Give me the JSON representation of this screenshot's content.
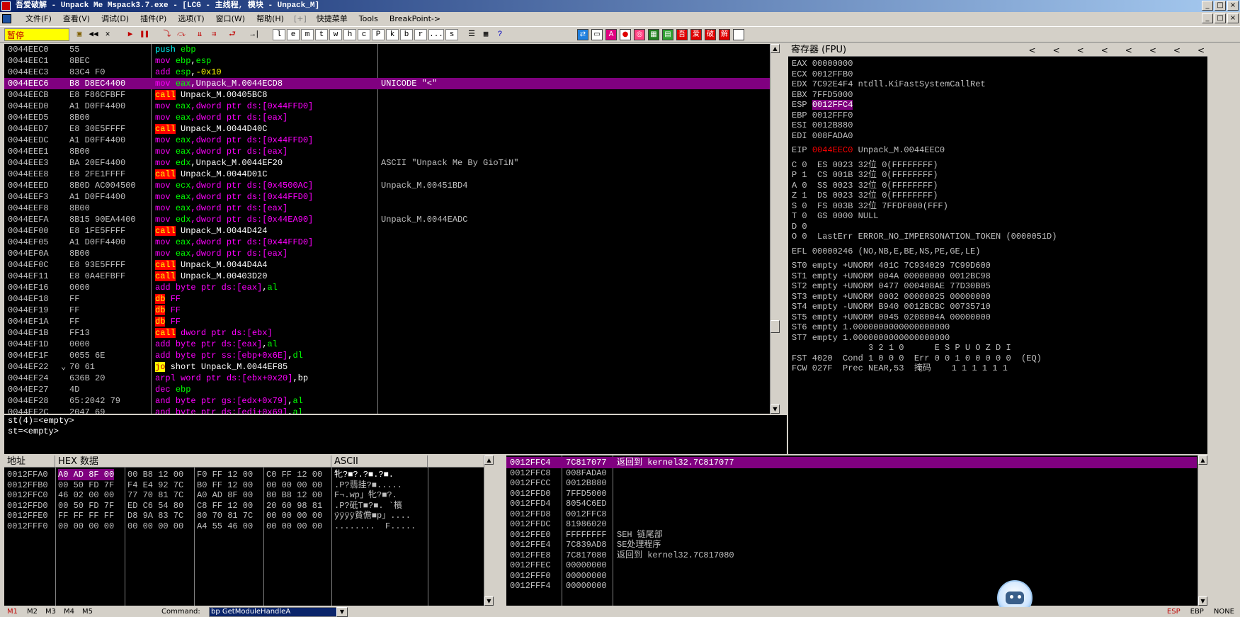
{
  "window": {
    "title": "吾爱破解 - Unpack Me Mspack3.7.exe - [LCG - 主线程, 模块 - Unpack_M]",
    "controls": [
      "_",
      "□",
      "×"
    ]
  },
  "menu": {
    "items": [
      "文件(F)",
      "查看(V)",
      "调试(D)",
      "插件(P)",
      "选项(T)",
      "窗口(W)",
      "帮助(H)"
    ],
    "separator": "[+]",
    "extra": [
      "快捷菜单",
      "Tools",
      "BreakPoint->"
    ]
  },
  "toolbar": {
    "status": "暂停",
    "letters": [
      "l",
      "e",
      "m",
      "t",
      "w",
      "h",
      "c",
      "P",
      "k",
      "b",
      "r",
      "...",
      "s"
    ],
    "right_buttons": [
      "A",
      "●",
      "◎",
      "吾",
      "爱",
      "破",
      "解"
    ]
  },
  "disasm": {
    "rows": [
      {
        "addr": "0044EEC0",
        "hex": "55",
        "mnem": "push",
        "mclass": "push",
        "ops": [
          {
            "t": "ebp",
            "c": "reg"
          }
        ],
        "comment": ""
      },
      {
        "addr": "0044EEC1",
        "hex": "8BEC",
        "mnem": "mov",
        "mclass": "mov",
        "ops": [
          {
            "t": "ebp",
            "c": "reg"
          },
          {
            "t": ",",
            "c": "target"
          },
          {
            "t": "esp",
            "c": "reg"
          }
        ],
        "comment": ""
      },
      {
        "addr": "0044EEC3",
        "hex": "83C4 F0",
        "mnem": "add",
        "mclass": "add",
        "ops": [
          {
            "t": "esp",
            "c": "reg"
          },
          {
            "t": ",",
            "c": "target"
          },
          {
            "t": "-0x10",
            "c": "num"
          }
        ],
        "comment": ""
      },
      {
        "addr": "0044EEC6",
        "hex": "B8 D8EC4400",
        "mnem": "mov",
        "mclass": "mov",
        "ops": [
          {
            "t": "eax",
            "c": "reg"
          },
          {
            "t": ",Unpack_M.0044ECD8",
            "c": "target"
          }
        ],
        "comment": "UNICODE \"<\"",
        "hl": true
      },
      {
        "addr": "0044EECB",
        "hex": "E8 F86CFBFF",
        "mnem": "call",
        "mclass": "call",
        "ops": [
          {
            "t": "Unpack_M.00405BC8",
            "c": "target"
          }
        ],
        "comment": ""
      },
      {
        "addr": "0044EED0",
        "hex": "A1 D0FF4400",
        "mnem": "mov",
        "mclass": "mov",
        "ops": [
          {
            "t": "eax",
            "c": "reg"
          },
          {
            "t": ",dword ptr ds:[0x44FFD0]",
            "c": "mem"
          }
        ],
        "comment": ""
      },
      {
        "addr": "0044EED5",
        "hex": "8B00",
        "mnem": "mov",
        "mclass": "mov",
        "ops": [
          {
            "t": "eax",
            "c": "reg"
          },
          {
            "t": ",dword ptr ds:[eax]",
            "c": "mem"
          }
        ],
        "comment": ""
      },
      {
        "addr": "0044EED7",
        "hex": "E8 30E5FFFF",
        "mnem": "call",
        "mclass": "call",
        "ops": [
          {
            "t": "Unpack_M.0044D40C",
            "c": "target"
          }
        ],
        "comment": ""
      },
      {
        "addr": "0044EEDC",
        "hex": "A1 D0FF4400",
        "mnem": "mov",
        "mclass": "mov",
        "ops": [
          {
            "t": "eax",
            "c": "reg"
          },
          {
            "t": ",dword ptr ds:[0x44FFD0]",
            "c": "mem"
          }
        ],
        "comment": ""
      },
      {
        "addr": "0044EEE1",
        "hex": "8B00",
        "mnem": "mov",
        "mclass": "mov",
        "ops": [
          {
            "t": "eax",
            "c": "reg"
          },
          {
            "t": ",dword ptr ds:[eax]",
            "c": "mem"
          }
        ],
        "comment": ""
      },
      {
        "addr": "0044EEE3",
        "hex": "BA 20EF4400",
        "mnem": "mov",
        "mclass": "mov",
        "ops": [
          {
            "t": "edx",
            "c": "reg"
          },
          {
            "t": ",Unpack_M.0044EF20",
            "c": "target"
          }
        ],
        "comment": "ASCII \"Unpack Me By GioTiN\""
      },
      {
        "addr": "0044EEE8",
        "hex": "E8 2FE1FFFF",
        "mnem": "call",
        "mclass": "call",
        "ops": [
          {
            "t": "Unpack_M.0044D01C",
            "c": "target"
          }
        ],
        "comment": ""
      },
      {
        "addr": "0044EEED",
        "hex": "8B0D AC004500",
        "mnem": "mov",
        "mclass": "mov",
        "ops": [
          {
            "t": "ecx",
            "c": "reg"
          },
          {
            "t": ",dword ptr ds:[0x4500AC]",
            "c": "mem"
          }
        ],
        "comment": "Unpack_M.00451BD4"
      },
      {
        "addr": "0044EEF3",
        "hex": "A1 D0FF4400",
        "mnem": "mov",
        "mclass": "mov",
        "ops": [
          {
            "t": "eax",
            "c": "reg"
          },
          {
            "t": ",dword ptr ds:[0x44FFD0]",
            "c": "mem"
          }
        ],
        "comment": ""
      },
      {
        "addr": "0044EEF8",
        "hex": "8B00",
        "mnem": "mov",
        "mclass": "mov",
        "ops": [
          {
            "t": "eax",
            "c": "reg"
          },
          {
            "t": ",dword ptr ds:[eax]",
            "c": "mem"
          }
        ],
        "comment": ""
      },
      {
        "addr": "0044EEFA",
        "hex": "8B15 90EA4400",
        "mnem": "mov",
        "mclass": "mov",
        "ops": [
          {
            "t": "edx",
            "c": "reg"
          },
          {
            "t": ",dword ptr ds:[0x44EA90]",
            "c": "mem"
          }
        ],
        "comment": "Unpack_M.0044EADC"
      },
      {
        "addr": "0044EF00",
        "hex": "E8 1FE5FFFF",
        "mnem": "call",
        "mclass": "call",
        "ops": [
          {
            "t": "Unpack_M.0044D424",
            "c": "target"
          }
        ],
        "comment": ""
      },
      {
        "addr": "0044EF05",
        "hex": "A1 D0FF4400",
        "mnem": "mov",
        "mclass": "mov",
        "ops": [
          {
            "t": "eax",
            "c": "reg"
          },
          {
            "t": ",dword ptr ds:[0x44FFD0]",
            "c": "mem"
          }
        ],
        "comment": ""
      },
      {
        "addr": "0044EF0A",
        "hex": "8B00",
        "mnem": "mov",
        "mclass": "mov",
        "ops": [
          {
            "t": "eax",
            "c": "reg"
          },
          {
            "t": ",dword ptr ds:[eax]",
            "c": "mem"
          }
        ],
        "comment": ""
      },
      {
        "addr": "0044EF0C",
        "hex": "E8 93E5FFFF",
        "mnem": "call",
        "mclass": "call",
        "ops": [
          {
            "t": "Unpack_M.0044D4A4",
            "c": "target"
          }
        ],
        "comment": ""
      },
      {
        "addr": "0044EF11",
        "hex": "E8 0A4EFBFF",
        "mnem": "call",
        "mclass": "call",
        "ops": [
          {
            "t": "Unpack_M.00403D20",
            "c": "target"
          }
        ],
        "comment": ""
      },
      {
        "addr": "0044EF16",
        "hex": "0000",
        "mnem": "add",
        "mclass": "add",
        "ops": [
          {
            "t": "byte ptr ds:[eax]",
            "c": "mem"
          },
          {
            "t": ",",
            "c": "target"
          },
          {
            "t": "al",
            "c": "reg"
          }
        ],
        "comment": ""
      },
      {
        "addr": "0044EF18",
        "hex": "FF",
        "mnem": "db",
        "mclass": "db",
        "ops": [
          {
            "t": "FF",
            "c": "mem"
          }
        ],
        "comment": ""
      },
      {
        "addr": "0044EF19",
        "hex": "FF",
        "mnem": "db",
        "mclass": "db",
        "ops": [
          {
            "t": "FF",
            "c": "mem"
          }
        ],
        "comment": ""
      },
      {
        "addr": "0044EF1A",
        "hex": "FF",
        "mnem": "db",
        "mclass": "db",
        "ops": [
          {
            "t": "FF",
            "c": "mem"
          }
        ],
        "comment": ""
      },
      {
        "addr": "0044EF1B",
        "hex": "FF13",
        "mnem": "call",
        "mclass": "call",
        "ops": [
          {
            "t": "dword ptr ds:[ebx]",
            "c": "mem"
          }
        ],
        "comment": ""
      },
      {
        "addr": "0044EF1D",
        "hex": "0000",
        "mnem": "add",
        "mclass": "add",
        "ops": [
          {
            "t": "byte ptr ds:[eax]",
            "c": "mem"
          },
          {
            "t": ",",
            "c": "target"
          },
          {
            "t": "al",
            "c": "reg"
          }
        ],
        "comment": ""
      },
      {
        "addr": "0044EF1F",
        "hex": "0055 6E",
        "mnem": "add",
        "mclass": "add",
        "ops": [
          {
            "t": "byte ptr ss:[ebp+0x6E]",
            "c": "mem"
          },
          {
            "t": ",",
            "c": "target"
          },
          {
            "t": "dl",
            "c": "reg"
          }
        ],
        "comment": ""
      },
      {
        "addr": "0044EF22",
        "hex": "70 61",
        "mnem": "jo",
        "mclass": "jo",
        "ops": [
          {
            "t": "short Unpack_M.0044EF85",
            "c": "target"
          }
        ],
        "comment": "",
        "jump": "⌄"
      },
      {
        "addr": "0044EF24",
        "hex": "636B 20",
        "mnem": "arpl",
        "mclass": "arpl",
        "ops": [
          {
            "t": "word ptr ds:[ebx+0x20]",
            "c": "mem"
          },
          {
            "t": ",bp",
            "c": "target"
          }
        ],
        "comment": ""
      },
      {
        "addr": "0044EF27",
        "hex": "4D",
        "mnem": "dec",
        "mclass": "dec",
        "ops": [
          {
            "t": "ebp",
            "c": "reg"
          }
        ],
        "comment": ""
      },
      {
        "addr": "0044EF28",
        "hex": "65:2042 79",
        "mnem": "and",
        "mclass": "and",
        "ops": [
          {
            "t": "byte ptr gs:[edx+0x79]",
            "c": "mem"
          },
          {
            "t": ",",
            "c": "target"
          },
          {
            "t": "al",
            "c": "reg"
          }
        ],
        "comment": ""
      },
      {
        "addr": "0044EF2C",
        "hex": "2047 69",
        "mnem": "and",
        "mclass": "and",
        "ops": [
          {
            "t": "byte ptr ds:[edi+0x69]",
            "c": "mem"
          },
          {
            "t": ",",
            "c": "target"
          },
          {
            "t": "al",
            "c": "reg"
          }
        ],
        "comment": ""
      }
    ]
  },
  "info": {
    "lines": [
      "st(4)=<empty>",
      "st=<empty>"
    ]
  },
  "registers": {
    "header": "寄存器 (FPU)",
    "nav_arrows": [
      "<",
      "<",
      "<",
      "<",
      "<",
      "<",
      "<",
      "<"
    ],
    "lines": [
      {
        "text": "EAX 00000000"
      },
      {
        "text": "ECX 0012FFB0"
      },
      {
        "text": "EDX 7C92E4F4 ntdll.KiFastSystemCallRet"
      },
      {
        "text": "EBX 7FFD5000"
      },
      {
        "text": "ESP ",
        "hl": "0012FFC4"
      },
      {
        "text": "EBP 0012FFF0"
      },
      {
        "text": "ESI 0012B880"
      },
      {
        "text": "EDI 008FADA0"
      },
      {
        "gap": true
      },
      {
        "text": "EIP ",
        "red": "0044EEC0",
        "after": " Unpack_M.0044EEC0"
      },
      {
        "gap": true
      },
      {
        "text": "C 0  ES 0023 32位 0(FFFFFFFF)"
      },
      {
        "text": "P 1  CS 001B 32位 0(FFFFFFFF)"
      },
      {
        "text": "A 0  SS 0023 32位 0(FFFFFFFF)"
      },
      {
        "text": "Z 1  DS 0023 32位 0(FFFFFFFF)"
      },
      {
        "text": "S 0  FS 003B 32位 7FFDF000(FFF)"
      },
      {
        "text": "T 0  GS 0000 NULL"
      },
      {
        "text": "D 0"
      },
      {
        "text": "O 0  LastErr ERROR_NO_IMPERSONATION_TOKEN (0000051D)"
      },
      {
        "gap": true
      },
      {
        "text": "EFL 00000246 (NO,NB,E,BE,NS,PE,GE,LE)"
      },
      {
        "gap": true
      },
      {
        "text": "ST0 empty +UNORM 401C 7C934029 7C99D600"
      },
      {
        "text": "ST1 empty +UNORM 004A 00000000 0012BC98"
      },
      {
        "text": "ST2 empty +UNORM 0477 000408AE 77D30B05"
      },
      {
        "text": "ST3 empty +UNORM 0002 00000025 00000000"
      },
      {
        "text": "ST4 empty -UNORM B940 0012BCBC 00735710"
      },
      {
        "text": "ST5 empty +UNORM 0045 0208004A 00000000"
      },
      {
        "text": "ST6 empty 1.0000000000000000000"
      },
      {
        "text": "ST7 empty 1.0000000000000000000"
      },
      {
        "text": "               3 2 1 0      E S P U O Z D I"
      },
      {
        "text": "FST 4020  Cond 1 0 0 0  Err 0 0 1 0 0 0 0 0  (EQ)"
      },
      {
        "text": "FCW 027F  Prec NEAR,53  掩码    1 1 1 1 1 1"
      }
    ]
  },
  "dump": {
    "headers": [
      "地址",
      "HEX 数据",
      "ASCII"
    ],
    "rows": [
      {
        "addr": "0012FFA0",
        "b1": "A0 AD 8F 00",
        "b2": "00 B8 12 00",
        "b3": "F0 FF 12 00",
        "b4": "C0 FF 12 00",
        "ascii": "牝?■?.?■.?■.",
        "hl": true
      },
      {
        "addr": "0012FFB0",
        "b1": "00 50 FD 7F",
        "b2": "F4 E4 92 7C",
        "b3": "B0 FF 12 00",
        "b4": "00 00 00 00",
        "ascii": ".P?翡挂?■....."
      },
      {
        "addr": "0012FFC0",
        "b1": "46 02 00 00",
        "b2": "77 70 81 7C",
        "b3": "A0 AD 8F 00",
        "b4": "80 B8 12 00",
        "ascii": "F¬.wp」牝?■?."
      },
      {
        "addr": "0012FFD0",
        "b1": "00 50 FD 7F",
        "b2": "ED C6 54 80",
        "b3": "C8 FF 12 00",
        "b4": "20 60 98 81",
        "ascii": ".P?砥T■?■. `檳"
      },
      {
        "addr": "0012FFE0",
        "b1": "FF FF FF FF",
        "b2": "D8 9A 83 7C",
        "b3": "80 70 81 7C",
        "b4": "00 00 00 00",
        "ascii": "ÿÿÿÿ貧儋■p」...."
      },
      {
        "addr": "0012FFF0",
        "b1": "00 00 00 00",
        "b2": "00 00 00 00",
        "b3": "A4 55 46 00",
        "b4": "00 00 00 00",
        "ascii": "........  F....."
      }
    ]
  },
  "stack": {
    "rows": [
      {
        "addr": "0012FFC4",
        "val": "7C817077",
        "cmt": "返回到 kernel32.7C817077",
        "hl": true
      },
      {
        "addr": "0012FFC8",
        "val": "008FADA0",
        "cmt": ""
      },
      {
        "addr": "0012FFCC",
        "val": "0012B880",
        "cmt": ""
      },
      {
        "addr": "0012FFD0",
        "val": "7FFD5000",
        "cmt": ""
      },
      {
        "addr": "0012FFD4",
        "val": "8054C6ED",
        "cmt": ""
      },
      {
        "addr": "0012FFD8",
        "val": "0012FFC8",
        "cmt": ""
      },
      {
        "addr": "0012FFDC",
        "val": "81986020",
        "cmt": ""
      },
      {
        "addr": "0012FFE0",
        "val": "FFFFFFFF",
        "cmt": "SEH 链尾部"
      },
      {
        "addr": "0012FFE4",
        "val": "7C839AD8",
        "cmt": "SE处理程序"
      },
      {
        "addr": "0012FFE8",
        "val": "7C817080",
        "cmt": "返回到 kernel32.7C817080"
      },
      {
        "addr": "0012FFEC",
        "val": "00000000",
        "cmt": ""
      },
      {
        "addr": "0012FFF0",
        "val": "00000000",
        "cmt": ""
      },
      {
        "addr": "0012FFF4",
        "val": "00000000",
        "cmt": ""
      }
    ]
  },
  "bottom": {
    "tabs": [
      "M1",
      "M2",
      "M3",
      "M4",
      "M5"
    ],
    "command_label": "Command:",
    "command_value": "bp GetModuleHandleA",
    "status": [
      "ESP",
      "EBP",
      "NONE"
    ]
  }
}
